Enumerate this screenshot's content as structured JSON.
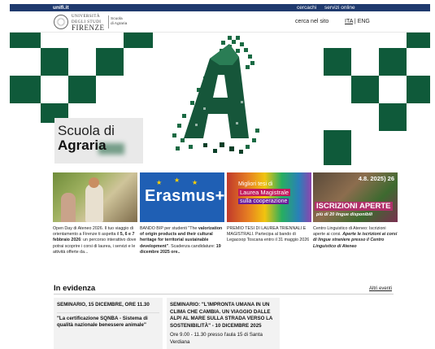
{
  "topbar": {
    "site": "unifi.it",
    "cercachi": "cercachi",
    "servizi": "servizi online"
  },
  "header": {
    "logo_line1": "UNIVERSITÀ",
    "logo_line2": "DEGLI STUDI",
    "logo_line3": "FIRENZE",
    "logo_sub1": "Scuola",
    "logo_sub2": "di Agraria",
    "search": "cerca nel sito",
    "lang_ita": "ITA",
    "lang_sep": " | ",
    "lang_eng": "ENG"
  },
  "hero": {
    "title_line1": "Scuola di",
    "title_line2": "Agraria"
  },
  "cards": [
    {
      "text_pre": "Open Day di Ateneo 2026. Il tuo viaggio di orientamento a Firenze ti aspetta il ",
      "text_bold": "5, 6 e 7 febbraio 2026",
      "text_post": ": un percorso interattivo dove potrai scoprire i corsi di laurea, i servizi e le attività offerte da..."
    },
    {
      "text_pre": "BANDO BIP per studenti \"The ",
      "text_bold": "valorization of origin products and their cultural heritage for territorial sustainable development\"",
      "text_post": ". Scadenza candidature: ",
      "text_bold2": "19 dicembre 2025 ore..",
      "img_label": "Erasmus+"
    },
    {
      "text": "PREMIO TESI DI LAUREA TRIENNALI E MAGISTRALI. Partecipa al bando di Legacoop Toscana entro il 31 maggio 2026",
      "img_line1": "Migliori tesi di",
      "img_line2": "Laurea Magistrale",
      "img_line3": "sulla cooperazione"
    },
    {
      "text_pre": "Centro Linguistico di Ateneo: Iscrizioni aperte ai corsi. ",
      "text_italic": "Aperte le iscrizioni ai corsi di lingue straniere presso il Centro Linguistico di Ateneo",
      "img_date": "4.8. 2025) 26",
      "img_title": "ISCRIZIONI APERTE",
      "img_sub": "più di 20 lingue disponibili"
    }
  ],
  "evidenza": {
    "title": "In evidenza",
    "more": "Altri eventi",
    "events": [
      {
        "heading": "SEMINARIO, 15 DICEMBRE, ORE 11.30",
        "body": "\"La certificazione SQNBA - Sistema di qualità nazionale benessere animale\""
      },
      {
        "heading": "SEMINARIO: \"L'IMPRONTA UMANA IN UN CLIMA CHE CAMBIA. UN VIAGGIO DALLE ALPI AL MARE SULLA STRADA VERSO LA SOSTENIBILITÀ\" - 10 DICEMBRE 2025",
        "body": "Ore 9.00 - 11.30 presso l'aula 15 di Santa Verdiana"
      }
    ]
  },
  "colors": {
    "topbar": "#1f3a6e",
    "brand_green": "#0f5a3a",
    "erasmus_blue": "#1f5fb4"
  }
}
